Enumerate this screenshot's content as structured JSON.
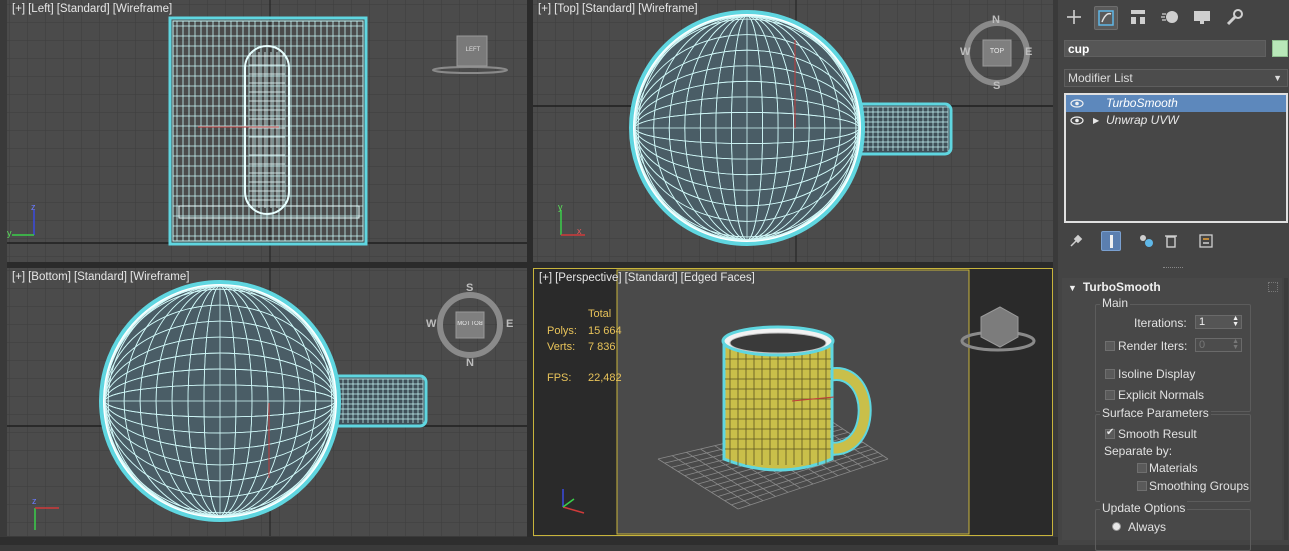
{
  "viewports": [
    {
      "id": "left",
      "labels": [
        "[+]",
        "[Left]",
        "[Standard]",
        "[Wireframe]"
      ]
    },
    {
      "id": "top",
      "labels": [
        "[+]",
        "[Top]",
        "[Standard]",
        "[Wireframe]"
      ],
      "compass": {
        "n": "N",
        "s": "S",
        "w": "W",
        "e": "E"
      },
      "cube_face": "TOP"
    },
    {
      "id": "bottom",
      "labels": [
        "[+]",
        "[Bottom]",
        "[Standard]",
        "[Wireframe]"
      ],
      "compass": {
        "n": "N",
        "s": "S",
        "w": "W",
        "e": "E"
      },
      "cube_face": "BOTTOM"
    },
    {
      "id": "perspective",
      "labels": [
        "[+]",
        "[Perspective]",
        "[Standard]",
        "[Edged Faces]"
      ]
    }
  ],
  "left_cube_face": "LEFT",
  "stats": {
    "header": "Total",
    "polys_label": "Polys:",
    "polys_value": "15 664",
    "verts_label": "Verts:",
    "verts_value": "7 836",
    "fps_label": "FPS:",
    "fps_value": "22,482"
  },
  "axis_labels": {
    "x": "x",
    "y": "y",
    "z": "z"
  },
  "command_panel": {
    "tabs": [
      "create-icon",
      "modify-icon",
      "hierarchy-icon",
      "motion-icon",
      "display-icon",
      "utilities-icon"
    ],
    "active_tab": "modify-icon",
    "object_name": "cup",
    "object_color": "#b9e8b9",
    "modifier_list_label": "Modifier List",
    "stack": [
      {
        "name": "TurboSmooth",
        "selected": true,
        "expandable": false
      },
      {
        "name": "Unwrap UVW",
        "selected": false,
        "expandable": true
      }
    ],
    "stack_buttons": [
      "pin-icon",
      "show-end-result-icon",
      "make-unique-icon",
      "remove-modifier-icon",
      "configure-icon"
    ]
  },
  "turbosmooth": {
    "title": "TurboSmooth",
    "main_group": "Main",
    "iterations_label": "Iterations:",
    "iterations_value": "1",
    "render_iters_label": "Render Iters:",
    "render_iters_value": "0",
    "render_iters_checked": false,
    "isoline_label": "Isoline Display",
    "isoline_checked": false,
    "explicit_normals_label": "Explicit Normals",
    "explicit_normals_checked": false,
    "surface_group": "Surface Parameters",
    "smooth_result_label": "Smooth Result",
    "smooth_result_checked": true,
    "separate_by_label": "Separate by:",
    "materials_label": "Materials",
    "materials_checked": false,
    "smoothing_groups_label": "Smoothing Groups",
    "smoothing_groups_checked": false,
    "update_group": "Update Options",
    "always_label": "Always"
  },
  "colors": {
    "wire": "#aef0f0",
    "selection_glow": "#5fd6e0",
    "perspective_border": "#c8b43c",
    "mug_body": "#c9bf4a",
    "stack_selected": "#5d88bc"
  }
}
